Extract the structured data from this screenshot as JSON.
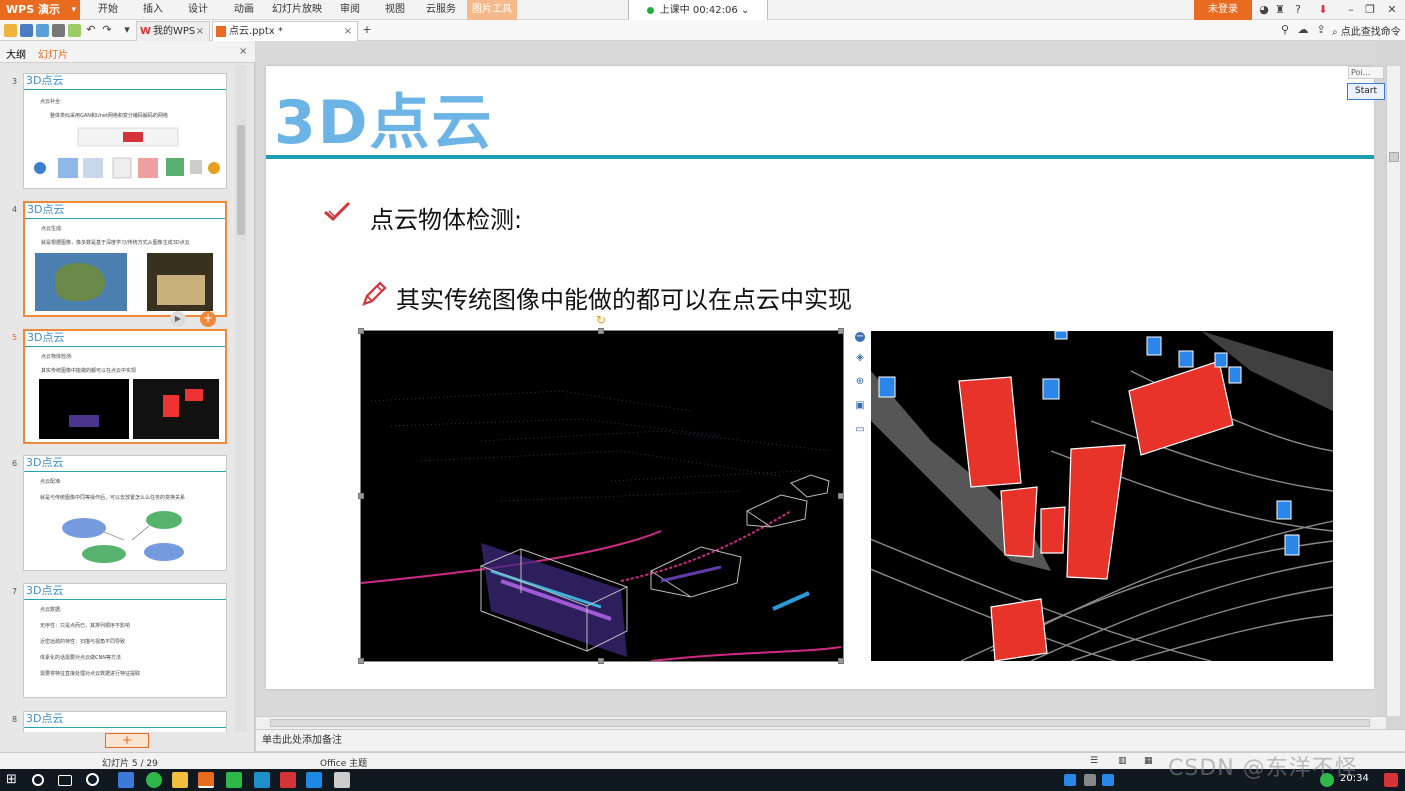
{
  "app": {
    "menu_label": "WPS 演示",
    "ribbon_tabs": [
      "开始",
      "插入",
      "设计",
      "动画",
      "幻灯片放映",
      "审阅",
      "视图",
      "云服务",
      "图片工具"
    ],
    "timer": "上课中 00:42:06",
    "login": "未登录",
    "find_command": "点此查找命令",
    "doc_tabs": [
      {
        "label": "我的WPS"
      },
      {
        "label": "点云.pptx *"
      }
    ]
  },
  "left_panel": {
    "tabs": [
      "大纲",
      "幻灯片"
    ],
    "thumbs": [
      {
        "num": "3",
        "title": "3D点云",
        "lines": [
          "点云补全:",
          "整体类似采用GAN和Unet网络和变分编码解码的网络"
        ]
      },
      {
        "num": "4",
        "title": "3D点云",
        "lines": [
          "点云生成:",
          "就是根据图像，像多数是基于深度学习/传统方式从图像生成3D点云"
        ]
      },
      {
        "num": "5",
        "title": "3D点云",
        "lines": [
          "点云物体检测:",
          "其实传统图像中能做的都可以在点云中实现"
        ]
      },
      {
        "num": "6",
        "title": "3D点云",
        "lines": [
          "点云配准:",
          "就是与传统图像中同等操作后，可以去放置怎么么任务的变换关系"
        ]
      },
      {
        "num": "7",
        "title": "3D点云",
        "lines": [
          "点云数据:",
          "无序性：只是点而已，其排列顺序不影响",
          "近密远疏的特性：扫描与视角不同导致",
          "体素化的话需要对点云做CNN等方法",
          "需要将特征直接处理对点云数据进行特征提取"
        ]
      },
      {
        "num": "8",
        "title": "3D点云",
        "lines": []
      }
    ],
    "add_label": "+"
  },
  "slide": {
    "title": "3D点云",
    "bullet1": "点云物体检测:",
    "bullet2": "其实传统图像中能做的都可以在点云中实现"
  },
  "pip": {
    "label": "Poi...",
    "start": "Start"
  },
  "notes_placeholder": "单击此处添加备注",
  "status": {
    "slide_counter": "幻灯片 5 / 29",
    "theme": "Office 主题"
  },
  "taskbar": {
    "time": "20:34"
  },
  "watermark": "CSDN @东洋不怪",
  "colors": {
    "accent_orange": "#e86b1f",
    "title_blue": "#6cb3e6",
    "rule_teal": "#1e9fb5",
    "icon_red": "#d6323a"
  }
}
